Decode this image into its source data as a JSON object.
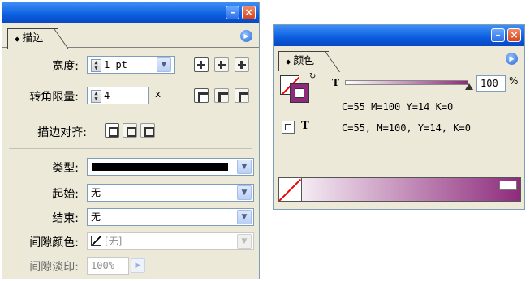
{
  "stroke_panel": {
    "tab_label": "描边",
    "tab_marker": "⬥",
    "weight_label": "宽度:",
    "weight_value": "1 pt",
    "miter_label": "转角限量:",
    "miter_value": "4",
    "miter_unit": "x",
    "align_label": "描边对齐:",
    "type_label": "类型:",
    "start_label": "起始:",
    "start_value": "无",
    "end_label": "结束:",
    "end_value": "无",
    "gap_color_label": "间隙颜色:",
    "gap_color_value": "[无]",
    "gap_tint_label": "间隙淡印:",
    "gap_tint_value": "100%"
  },
  "color_panel": {
    "tab_label": "颜色",
    "tab_marker": "⬥",
    "tint_letter": "T",
    "tint_value": "100",
    "tint_unit": "%",
    "cmyk_line1": "C=55 M=100 Y=14 K=0",
    "cmyk_line2": "C=55, M=100, Y=14, K=0",
    "text_letter": "T"
  },
  "colors": {
    "accent": "#8e2b7c",
    "titlebar": "#0a5ddf"
  }
}
